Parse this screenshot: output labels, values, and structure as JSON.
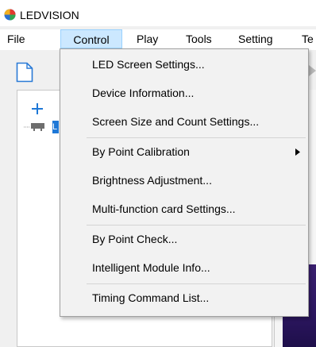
{
  "app": {
    "title": "LEDVISION",
    "logo_icon": "ledvision-logo-icon"
  },
  "menubar": {
    "items": [
      {
        "label": "File"
      },
      {
        "label": "Control",
        "active": true
      },
      {
        "label": "Play"
      },
      {
        "label": "Tools"
      },
      {
        "label": "Setting"
      },
      {
        "label": "Te"
      }
    ]
  },
  "toolbar": {
    "new_icon": "new-document-icon"
  },
  "tree": {
    "add_icon": "plus-icon",
    "node_icon": "monitor-node-icon",
    "node_label": "L"
  },
  "control_menu": {
    "items": [
      {
        "label": "LED Screen Settings..."
      },
      {
        "label": "Device Information..."
      },
      {
        "label": "Screen Size and Count Settings..."
      },
      {
        "label": "By Point Calibration",
        "has_submenu": true
      },
      {
        "label": "Brightness Adjustment..."
      },
      {
        "label": "Multi-function card Settings..."
      },
      {
        "label": "By Point Check..."
      },
      {
        "label": "Intelligent Module Info..."
      },
      {
        "label": "Timing Command List..."
      }
    ]
  },
  "colors": {
    "menu_highlight": "#cce8ff",
    "menu_highlight_border": "#99d1ff",
    "tree_node_accent": "#1e78d7",
    "accent_green": "#3fae3f",
    "accent_purple": "#2c1660"
  }
}
